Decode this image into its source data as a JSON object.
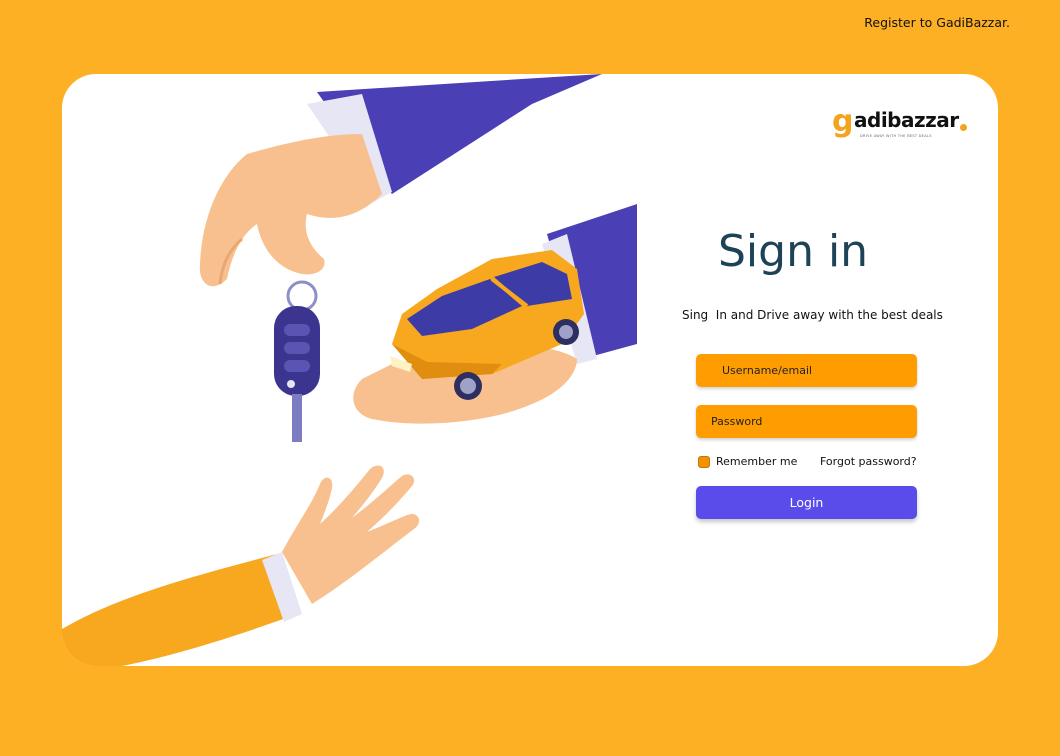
{
  "header": {
    "register_link": "Register to GadiBazzar."
  },
  "logo": {
    "g_letter": "g",
    "wordmark": "adibazzar",
    "tagline": "DRIVE AWAY WITH THE BEST DEALS"
  },
  "signin": {
    "title": "Sign in",
    "subtitle": "Sing  In and Drive away with the best deals",
    "username_placeholder": "Username/email",
    "password_placeholder": "Password",
    "remember_label": "Remember me",
    "forgot_label": "Forgot password?",
    "login_label": "Login"
  },
  "colors": {
    "background": "#FDB023",
    "accent_orange": "#FF9D00",
    "button_purple": "#5A4BEB",
    "title_color": "#1E4258",
    "sleeve_blue": "#4A3FB5",
    "skin": "#F8C08E"
  },
  "icons": [
    "key-fob-icon",
    "car-icon",
    "hand-icon"
  ]
}
